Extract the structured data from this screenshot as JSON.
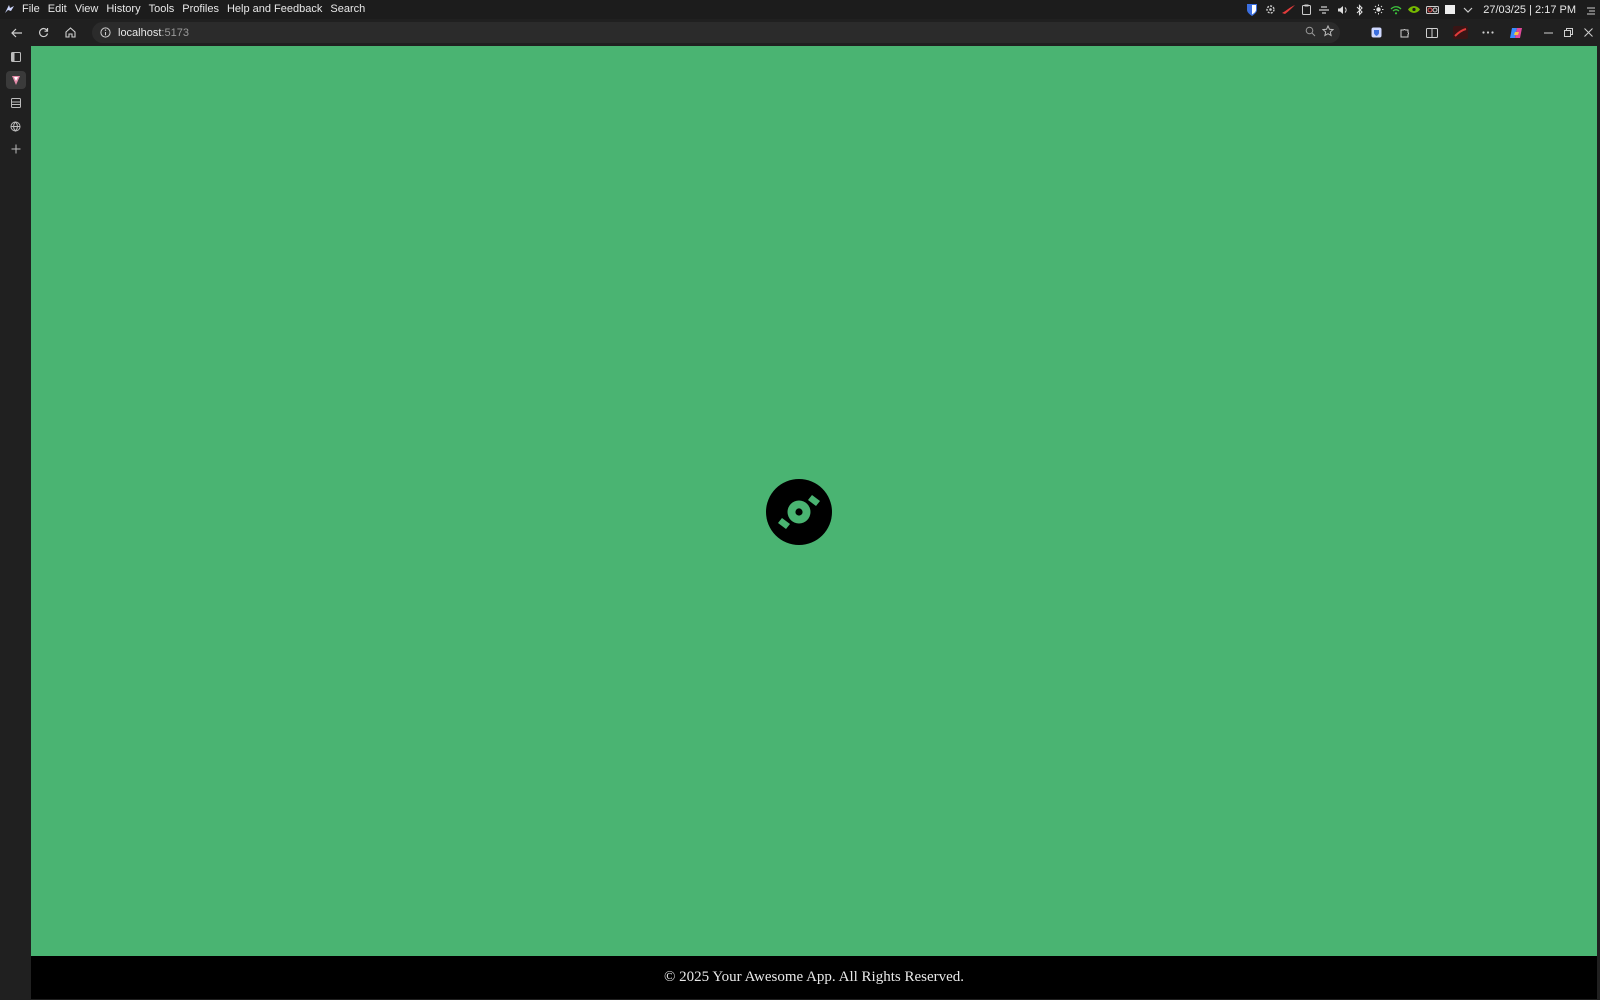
{
  "menubar": {
    "app_logo_icon": "browser-logo-icon",
    "items": [
      {
        "label": "File"
      },
      {
        "label": "Edit"
      },
      {
        "label": "View"
      },
      {
        "label": "History"
      },
      {
        "label": "Tools"
      },
      {
        "label": "Profiles"
      },
      {
        "label": "Help and Feedback"
      },
      {
        "label": "Search"
      }
    ]
  },
  "tray": {
    "icons": [
      "bitwarden-icon",
      "settings-icon",
      "rog-icon",
      "clipboard-icon",
      "network-icon",
      "volume-icon",
      "bluetooth-icon",
      "brightness-icon",
      "wifi-icon",
      "nvidia-icon",
      "gpu-icon",
      "memory-icon",
      "chevron-down-icon"
    ],
    "clock": "27/03/25 | 2:17 PM"
  },
  "toolbar": {
    "url_host": "localhost",
    "url_port": ":5173"
  },
  "page": {
    "background": "#4ab472",
    "loader_icon": "vinyl-disc-icon",
    "footer_text": "© 2025 Your Awesome App. All Rights Reserved."
  },
  "colors": {
    "accent": "#4ab472",
    "footer_bg": "#000000",
    "chrome_bg": "#202020"
  }
}
